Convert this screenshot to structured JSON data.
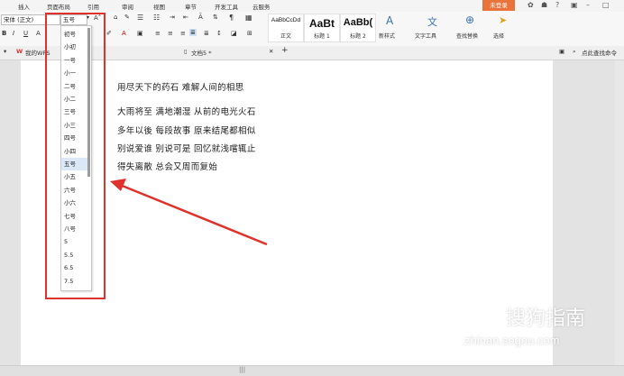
{
  "menubar": {
    "items": [
      "插入",
      "页面布局",
      "引用",
      "审阅",
      "视图",
      "章节",
      "开发工具",
      "云服务"
    ],
    "login_label": "未登录"
  },
  "ribbon": {
    "font_name": "宋体 (正文)",
    "font_size": "五号",
    "styles": [
      {
        "sample": "AaBbCcDd",
        "name": "正文"
      },
      {
        "sample": "AaBt",
        "name": "标题 1"
      },
      {
        "sample": "AaBb(",
        "name": "标题 2"
      }
    ],
    "new_style_label": "新样式",
    "text_tools_label": "文字工具",
    "find_replace_label": "查找替换",
    "select_label": "选择"
  },
  "tabbar": {
    "home_tab": "我的WPS",
    "doc_tab": "文档5 *",
    "hint": "点此查找命令"
  },
  "font_size_dropdown": {
    "options": [
      "初号",
      "小初",
      "一号",
      "小一",
      "二号",
      "小二",
      "三号",
      "小三",
      "四号",
      "小四",
      "五号",
      "小五",
      "六号",
      "小六",
      "七号",
      "八号",
      "5",
      "5.5",
      "6.5",
      "7.5"
    ],
    "selected": "五号"
  },
  "document": {
    "lines": [
      "用尽天下的药石  难解人间的相思",
      "大雨将至  满地潮湿  从前的电光火石",
      "多年以後  每段故事  原来结尾都相似",
      "别说爱谁  别说可是  回忆就浅嚐辄止",
      "得失离散  总会又周而复始"
    ]
  },
  "watermark": {
    "brand": "搜狗指南",
    "url": "zhinan.sogou.com"
  },
  "colors": {
    "highlight_box": "#e0322c",
    "arrow": "#e0322c",
    "login_bg": "#e8743b",
    "selected_item": "#dbe8f7"
  }
}
